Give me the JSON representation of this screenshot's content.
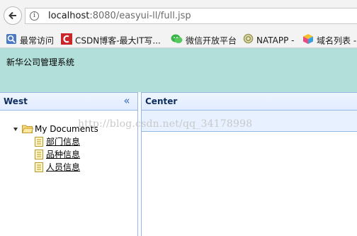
{
  "browser": {
    "url_host": "localhost",
    "url_rest": ":8080/easyui-ll/full.jsp"
  },
  "bookmarks": [
    {
      "label": "最常访问",
      "icon": "search-app-icon"
    },
    {
      "label": "CSDN博客-最大IT写...",
      "icon": "csdn-logo-icon"
    },
    {
      "label": "微信开放平台",
      "icon": "wechat-icon"
    },
    {
      "label": "NATAPP -",
      "icon": "natapp-icon"
    },
    {
      "label": "域名列表 -",
      "icon": "cube-icon"
    }
  ],
  "app": {
    "title": "新华公司管理系统"
  },
  "west": {
    "title": "West",
    "collapse_glyph": "«",
    "tree": {
      "root": "My Documents",
      "children": [
        "部门信息",
        "品种信息",
        "人员信息"
      ]
    }
  },
  "center": {
    "title": "Center"
  },
  "watermark": "http://blog.csdn.net/qq_34178998",
  "colors": {
    "header_bg": "#b3dfdb",
    "panel_border": "#95b8e7",
    "panel_header_bg": "#e0ecff"
  }
}
